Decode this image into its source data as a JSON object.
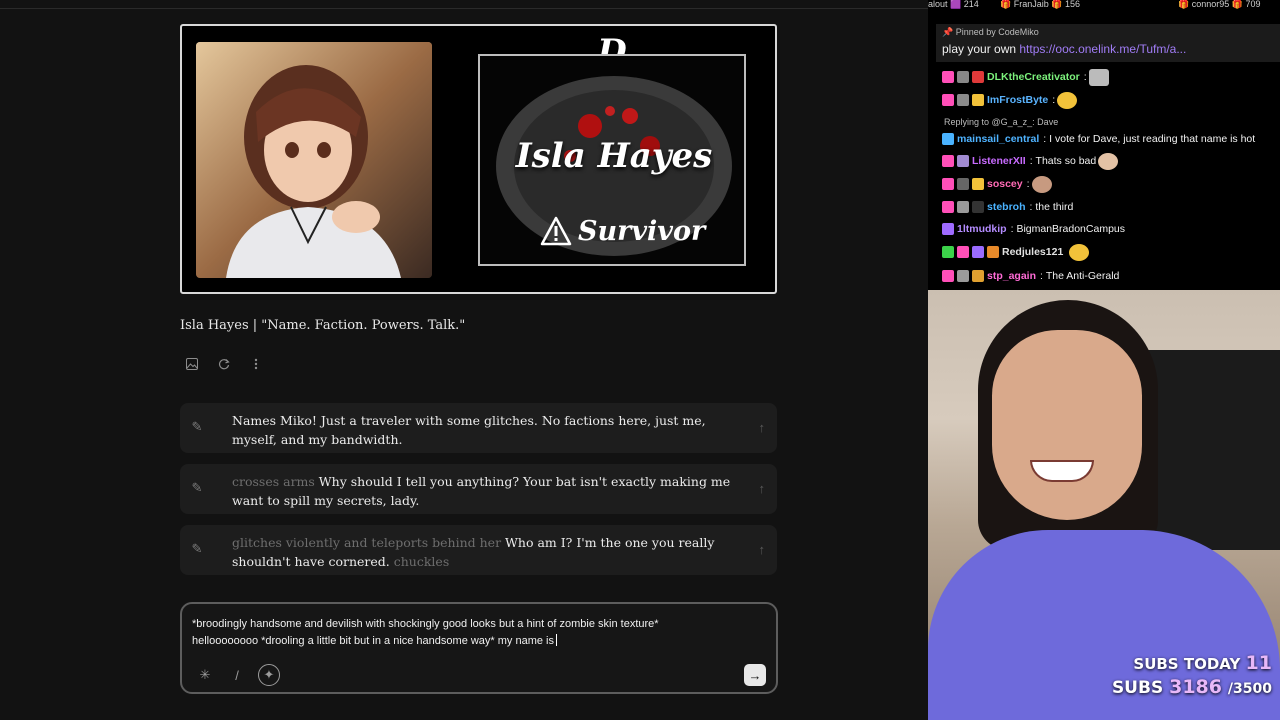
{
  "leaderboard": [
    {
      "name": "alout",
      "count": "214"
    },
    {
      "name": "FranJaib",
      "count": "156"
    },
    {
      "name": "connor95",
      "count": "709"
    }
  ],
  "character": {
    "rank": "D Rank",
    "name": "Isla Hayes",
    "status": "Survivor",
    "title": "Isla Hayes | \"Name. Faction. Powers. Talk.\""
  },
  "suggestions": [
    {
      "dim": "",
      "text": "Names Miko! Just a traveler with some glitches. No factions here, just me, myself, and my bandwidth.",
      "tail": ""
    },
    {
      "dim": "crosses arms",
      "text": "Why should I tell you anything? Your bat isn't exactly making me want to spill my secrets, lady.",
      "tail": ""
    },
    {
      "dim": "glitches violently and teleports behind her",
      "text": "Who am I? I'm the one you really shouldn't have cornered.",
      "tail": "chuckles"
    }
  ],
  "composer": {
    "draft": "*broodingly handsome and devilish with shockingly good looks but a hint of zombie skin texture* helloooooooo *drooling a little bit but in a nice handsome way* my name is"
  },
  "stream_chat": {
    "pinned_by": "Pinned by CodeMiko",
    "pinned_text": "play your own ",
    "pinned_link": "https://ooc.onelink.me/Tufm/a...",
    "reply_context": "Replying to @G_a_z_: Dave",
    "messages": [
      {
        "user": "DLKtheCreativator",
        "text": "",
        "color": "#7cf27c"
      },
      {
        "user": "ImFrostByte",
        "text": "",
        "color": "#5ab4ff"
      },
      {
        "user": "mainsail_central",
        "text": "I vote for Dave, just reading that name is hot",
        "color": "#4fb3ff"
      },
      {
        "user": "ListenerXII",
        "text": "Thats so bad",
        "color": "#c86bff"
      },
      {
        "user": "soscey",
        "text": "",
        "color": "#ff6bb5"
      },
      {
        "user": "stebroh",
        "text": "the third",
        "color": "#4ab3ff"
      },
      {
        "user": "1ltmudkip",
        "text": "BigmanBradonCampus",
        "color": "#b48cff"
      },
      {
        "user": "Redjules121",
        "text": "",
        "color": "#e0e0e0"
      },
      {
        "user": "stp_again",
        "text": "The Anti-Gerald",
        "color": "#ff6bd6"
      }
    ]
  },
  "subs": {
    "today_label": "SUBS TODAY",
    "today_value": "11",
    "total_label": "SUBS",
    "total_value": "3186",
    "goal": "/3500"
  }
}
